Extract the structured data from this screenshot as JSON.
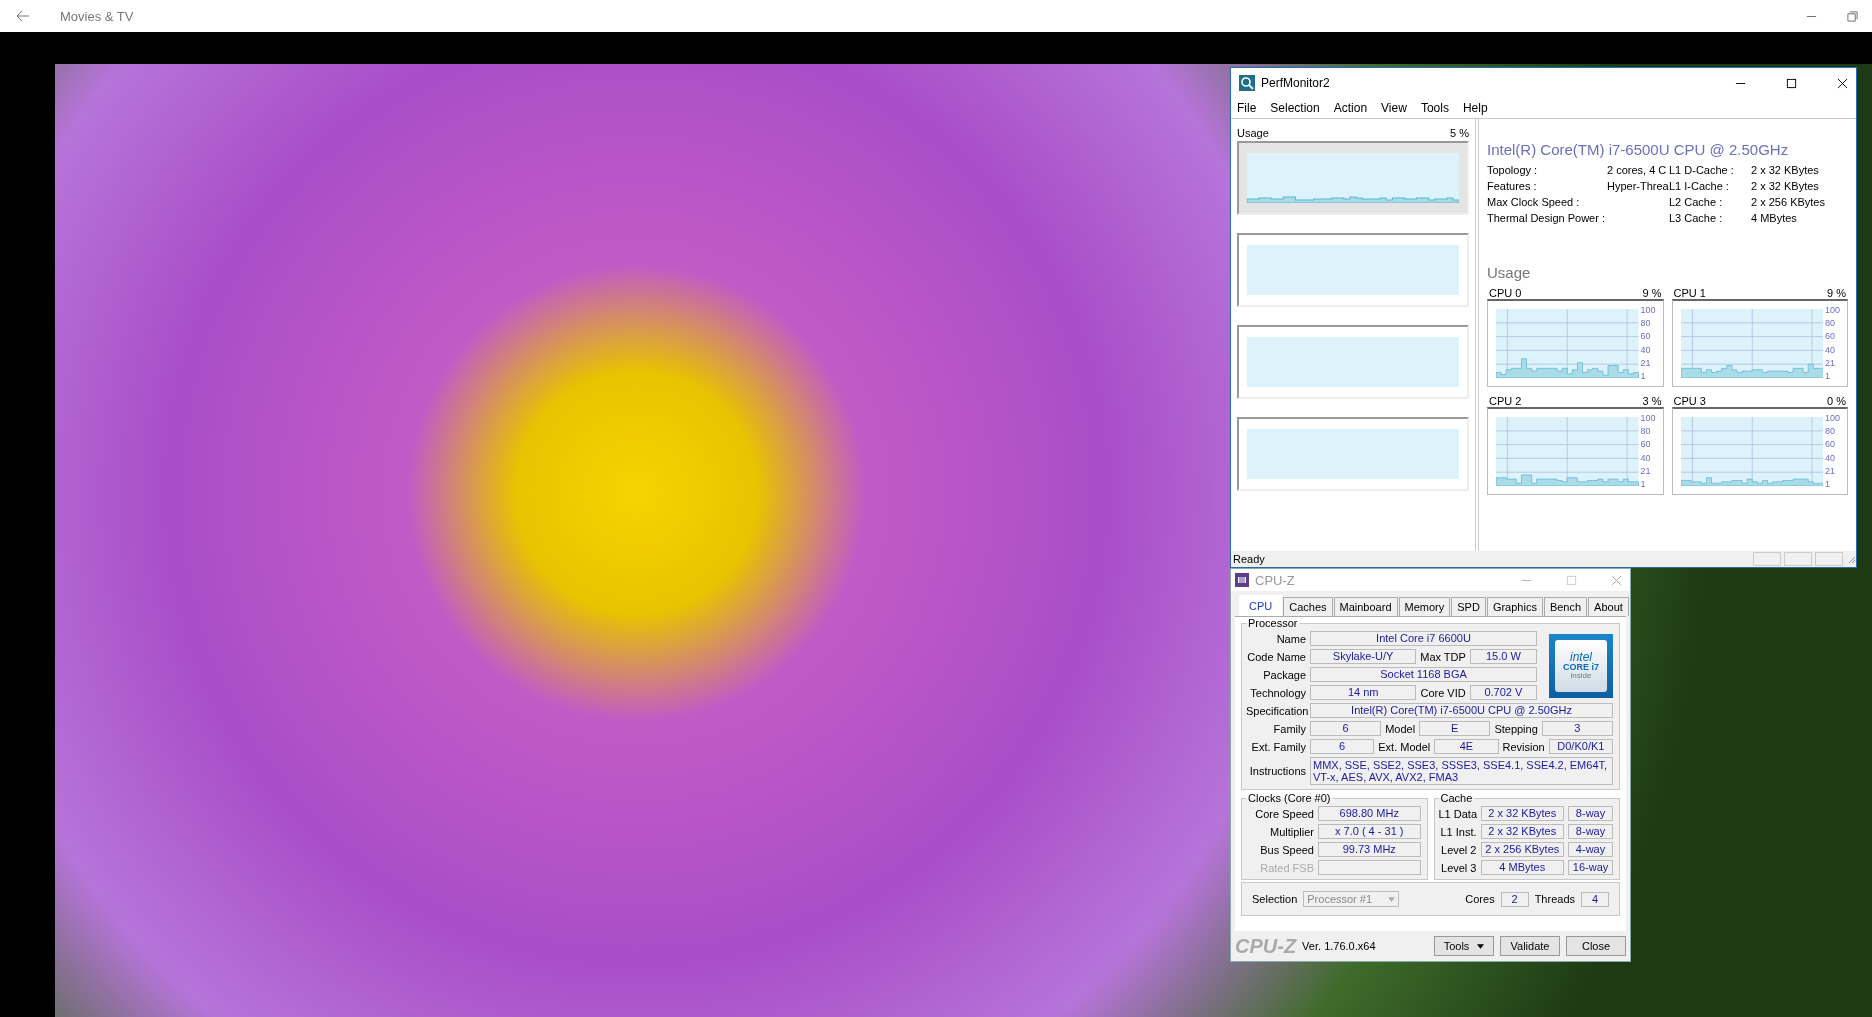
{
  "app": {
    "title": "Movies & TV"
  },
  "perfmonitor": {
    "title": "PerfMonitor2",
    "menu": [
      "File",
      "Selection",
      "Action",
      "View",
      "Tools",
      "Help"
    ],
    "overview": {
      "label": "Usage",
      "value": "5 %"
    },
    "cpu_name": "Intel(R) Core(TM) i7-6500U CPU @ 2.50GHz",
    "specs": [
      {
        "label": "Topology :",
        "value": "2 cores, 4 C",
        "cache_label": "L1 D-Cache :",
        "cache_value": "2 x 32 KBytes"
      },
      {
        "label": "Features :",
        "value": "Hyper-Threa",
        "cache_label": "L1 I-Cache :",
        "cache_value": "2 x 32 KBytes"
      },
      {
        "label": "Max Clock Speed :",
        "cache_label": "L2 Cache :",
        "cache_value": "2 x 256 KBytes"
      },
      {
        "label": "Thermal Design Power :",
        "cache_label": "L3 Cache :",
        "cache_value": "4 MBytes"
      }
    ],
    "usage_heading": "Usage",
    "cores": [
      {
        "name": "CPU 0",
        "value": "9 %",
        "axis": [
          "100",
          "80",
          "60",
          "40",
          "21",
          "1"
        ]
      },
      {
        "name": "CPU 1",
        "value": "9 %",
        "axis": [
          "100",
          "80",
          "60",
          "40",
          "21",
          "1"
        ]
      },
      {
        "name": "CPU 2",
        "value": "3 %",
        "axis": [
          "100",
          "80",
          "60",
          "40",
          "21",
          "1"
        ]
      },
      {
        "name": "CPU 3",
        "value": "0 %",
        "axis": [
          "100",
          "80",
          "60",
          "40",
          "21",
          "1"
        ]
      }
    ],
    "status": "Ready"
  },
  "cpuz": {
    "title": "CPU-Z",
    "tabs": [
      {
        "label": "CPU",
        "selected": true
      },
      {
        "label": "Caches",
        "selected": false
      },
      {
        "label": "Mainboard",
        "selected": false
      },
      {
        "label": "Memory",
        "selected": false
      },
      {
        "label": "SPD",
        "selected": false
      },
      {
        "label": "Graphics",
        "selected": false
      },
      {
        "label": "Bench",
        "selected": false
      },
      {
        "label": "About",
        "selected": false
      }
    ],
    "processor": {
      "title": "Processor",
      "top_rows": [
        [
          {
            "label": "Name",
            "value": "Intel Core i7 6600U"
          }
        ],
        [
          {
            "label": "Code Name",
            "value": "Skylake-U/Y"
          },
          {
            "label": "Max TDP",
            "value": "15.0 W"
          }
        ],
        [
          {
            "label": "Package",
            "value": "Socket 1168 BGA"
          }
        ],
        [
          {
            "label": "Technology",
            "value": "14 nm"
          },
          {
            "label": "Core VID",
            "value": "0.702 V"
          }
        ]
      ],
      "badge": {
        "brand": "intel",
        "line": "CORE i7",
        "tag": "inside"
      },
      "bottom_rows": [
        [
          {
            "label": "Specification",
            "value": "Intel(R) Core(TM) i7-6500U CPU @ 2.50GHz"
          }
        ],
        [
          {
            "label": "Family",
            "value": "6"
          },
          {
            "label": "Model",
            "value": "E"
          },
          {
            "label": "Stepping",
            "value": "3"
          }
        ],
        [
          {
            "label": "Ext. Family",
            "value": "6"
          },
          {
            "label": "Ext. Model",
            "value": "4E"
          },
          {
            "label": "Revision",
            "value": "D0/K0/K1"
          }
        ]
      ],
      "instructions": {
        "label": "Instructions",
        "value": "MMX, SSE, SSE2, SSE3, SSSE3, SSE4.1, SSE4.2, EM64T, VT-x, AES, AVX, AVX2, FMA3"
      }
    },
    "clocks": {
      "title": "Clocks (Core #0)",
      "rows": [
        {
          "label": "Core Speed",
          "value": "698.80 MHz",
          "disabled": false
        },
        {
          "label": "Multiplier",
          "value": "x 7.0 ( 4 - 31 )",
          "disabled": false
        },
        {
          "label": "Bus Speed",
          "value": "99.73 MHz",
          "disabled": false
        },
        {
          "label": "Rated FSB",
          "value": "",
          "disabled": true
        }
      ]
    },
    "cache": {
      "title": "Cache",
      "rows": [
        {
          "label": "L1 Data",
          "value": "2 x 32 KBytes",
          "ways": "8-way"
        },
        {
          "label": "L1 Inst.",
          "value": "2 x 32 KBytes",
          "ways": "8-way"
        },
        {
          "label": "Level 2",
          "value": "2 x 256 KBytes",
          "ways": "4-way"
        },
        {
          "label": "Level 3",
          "value": "4 MBytes",
          "ways": "16-way"
        }
      ]
    },
    "selection": {
      "label": "Selection",
      "value": "Processor #1",
      "cores_label": "Cores",
      "cores": "2",
      "threads_label": "Threads",
      "threads": "4"
    },
    "logo": "CPU-Z",
    "version": "Ver. 1.76.0.x64",
    "buttons": [
      "Tools",
      "Validate",
      "Close"
    ]
  }
}
